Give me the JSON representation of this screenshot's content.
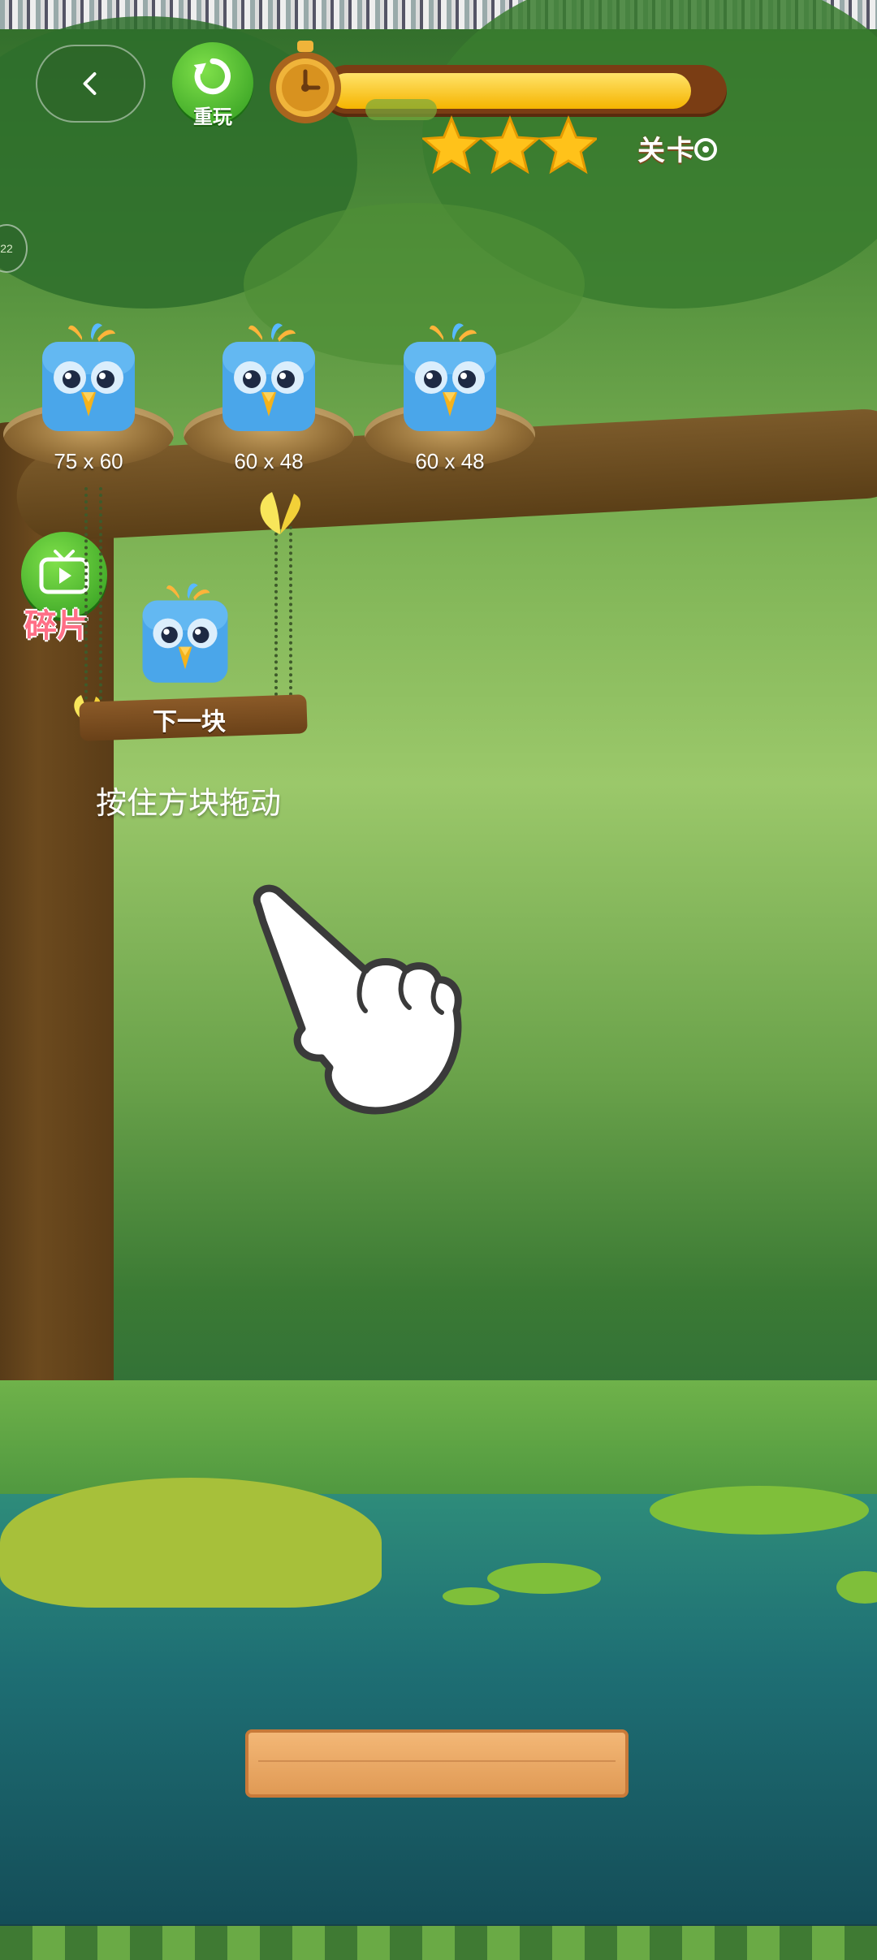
{
  "header": {
    "back_icon": "chevron-left-icon",
    "replay_label": "重玩",
    "timer_icon": "stopwatch-icon",
    "progress_fraction": 0.93,
    "progress_text": "",
    "stars_earned": 3,
    "level_label": "关卡"
  },
  "nests": [
    {
      "size": "75 x 60"
    },
    {
      "size": "60 x 48"
    },
    {
      "size": "60 x 48"
    }
  ],
  "side": {
    "piece_button_icon": "tv-play-icon",
    "piece_label": "碎片",
    "next_label": "下一块"
  },
  "hint_text": "按住方块拖动",
  "colors": {
    "bird_blue": "#4aa6ea",
    "green_button": "#2f9a1f",
    "progress_fill": "#f5b400",
    "star": "#ffc21a"
  }
}
